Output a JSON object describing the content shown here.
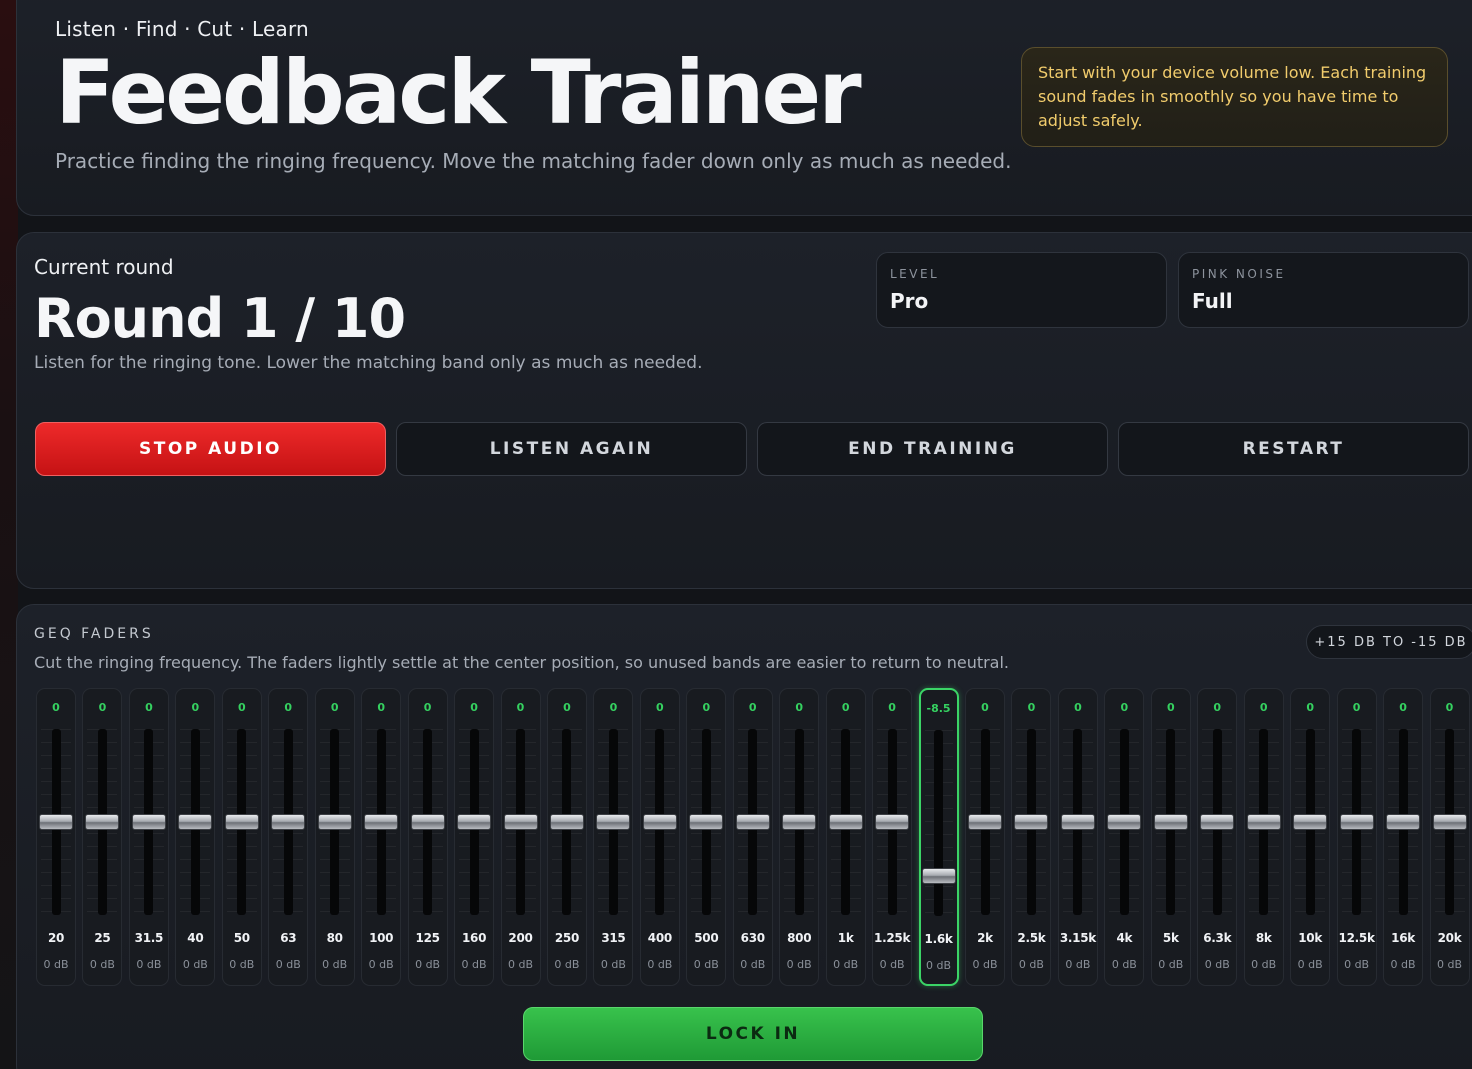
{
  "header": {
    "kicker": "Listen · Find · Cut · Learn",
    "title": "Feedback Trainer",
    "subtitle": "Practice finding the ringing frequency. Move the matching fader down only as much as needed.",
    "warning": "Start with your device volume low. Each training sound fades in smoothly so you have time to adjust safely."
  },
  "round": {
    "label": "Current round",
    "title": "Round 1 / 10",
    "instruction": "Listen for the ringing tone. Lower the matching band only as much as needed.",
    "level_key": "LEVEL",
    "level_value": "Pro",
    "pink_key": "PINK NOISE",
    "pink_value": "Full"
  },
  "buttons": {
    "stop": "STOP AUDIO",
    "listen": "LISTEN AGAIN",
    "end": "END TRAINING",
    "restart": "RESTART"
  },
  "geq": {
    "heading": "GEQ FADERS",
    "description": "Cut the ringing frequency. The faders lightly settle at the center position, so unused bands are easier to return to neutral.",
    "range": "+15 DB TO -15 DB",
    "range_max": 15,
    "range_min": -15,
    "active_color": "#3bd466",
    "bands": [
      {
        "freq": "20",
        "value": "0",
        "db": "0 dB",
        "level": 0
      },
      {
        "freq": "25",
        "value": "0",
        "db": "0 dB",
        "level": 0
      },
      {
        "freq": "31.5",
        "value": "0",
        "db": "0 dB",
        "level": 0
      },
      {
        "freq": "40",
        "value": "0",
        "db": "0 dB",
        "level": 0
      },
      {
        "freq": "50",
        "value": "0",
        "db": "0 dB",
        "level": 0
      },
      {
        "freq": "63",
        "value": "0",
        "db": "0 dB",
        "level": 0
      },
      {
        "freq": "80",
        "value": "0",
        "db": "0 dB",
        "level": 0
      },
      {
        "freq": "100",
        "value": "0",
        "db": "0 dB",
        "level": 0
      },
      {
        "freq": "125",
        "value": "0",
        "db": "0 dB",
        "level": 0
      },
      {
        "freq": "160",
        "value": "0",
        "db": "0 dB",
        "level": 0
      },
      {
        "freq": "200",
        "value": "0",
        "db": "0 dB",
        "level": 0
      },
      {
        "freq": "250",
        "value": "0",
        "db": "0 dB",
        "level": 0
      },
      {
        "freq": "315",
        "value": "0",
        "db": "0 dB",
        "level": 0
      },
      {
        "freq": "400",
        "value": "0",
        "db": "0 dB",
        "level": 0
      },
      {
        "freq": "500",
        "value": "0",
        "db": "0 dB",
        "level": 0
      },
      {
        "freq": "630",
        "value": "0",
        "db": "0 dB",
        "level": 0
      },
      {
        "freq": "800",
        "value": "0",
        "db": "0 dB",
        "level": 0
      },
      {
        "freq": "1k",
        "value": "0",
        "db": "0 dB",
        "level": 0
      },
      {
        "freq": "1.25k",
        "value": "0",
        "db": "0 dB",
        "level": 0
      },
      {
        "freq": "1.6k",
        "value": "-8.5",
        "db": "0 dB",
        "level": -8.5,
        "active": true
      },
      {
        "freq": "2k",
        "value": "0",
        "db": "0 dB",
        "level": 0
      },
      {
        "freq": "2.5k",
        "value": "0",
        "db": "0 dB",
        "level": 0
      },
      {
        "freq": "3.15k",
        "value": "0",
        "db": "0 dB",
        "level": 0
      },
      {
        "freq": "4k",
        "value": "0",
        "db": "0 dB",
        "level": 0
      },
      {
        "freq": "5k",
        "value": "0",
        "db": "0 dB",
        "level": 0
      },
      {
        "freq": "6.3k",
        "value": "0",
        "db": "0 dB",
        "level": 0
      },
      {
        "freq": "8k",
        "value": "0",
        "db": "0 dB",
        "level": 0
      },
      {
        "freq": "10k",
        "value": "0",
        "db": "0 dB",
        "level": 0
      },
      {
        "freq": "12.5k",
        "value": "0",
        "db": "0 dB",
        "level": 0
      },
      {
        "freq": "16k",
        "value": "0",
        "db": "0 dB",
        "level": 0
      },
      {
        "freq": "20k",
        "value": "0",
        "db": "0 dB",
        "level": 0
      }
    ],
    "lock_label": "LOCK IN"
  }
}
